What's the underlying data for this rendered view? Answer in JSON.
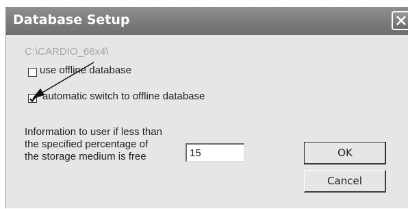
{
  "window": {
    "title": "Database Setup",
    "close_symbol": "close-icon"
  },
  "path_label": "C:\\CARDIO_66x4\\",
  "options": [
    {
      "label": "use offline database",
      "checked": false
    },
    {
      "label": "automatic switch to offline database",
      "checked": true
    }
  ],
  "info_text": [
    "Information to user if less than",
    "the specified percentage of",
    "the storage medium is free"
  ],
  "percent_input": {
    "value": "15"
  },
  "buttons": {
    "ok": "OK",
    "cancel": "Cancel"
  }
}
